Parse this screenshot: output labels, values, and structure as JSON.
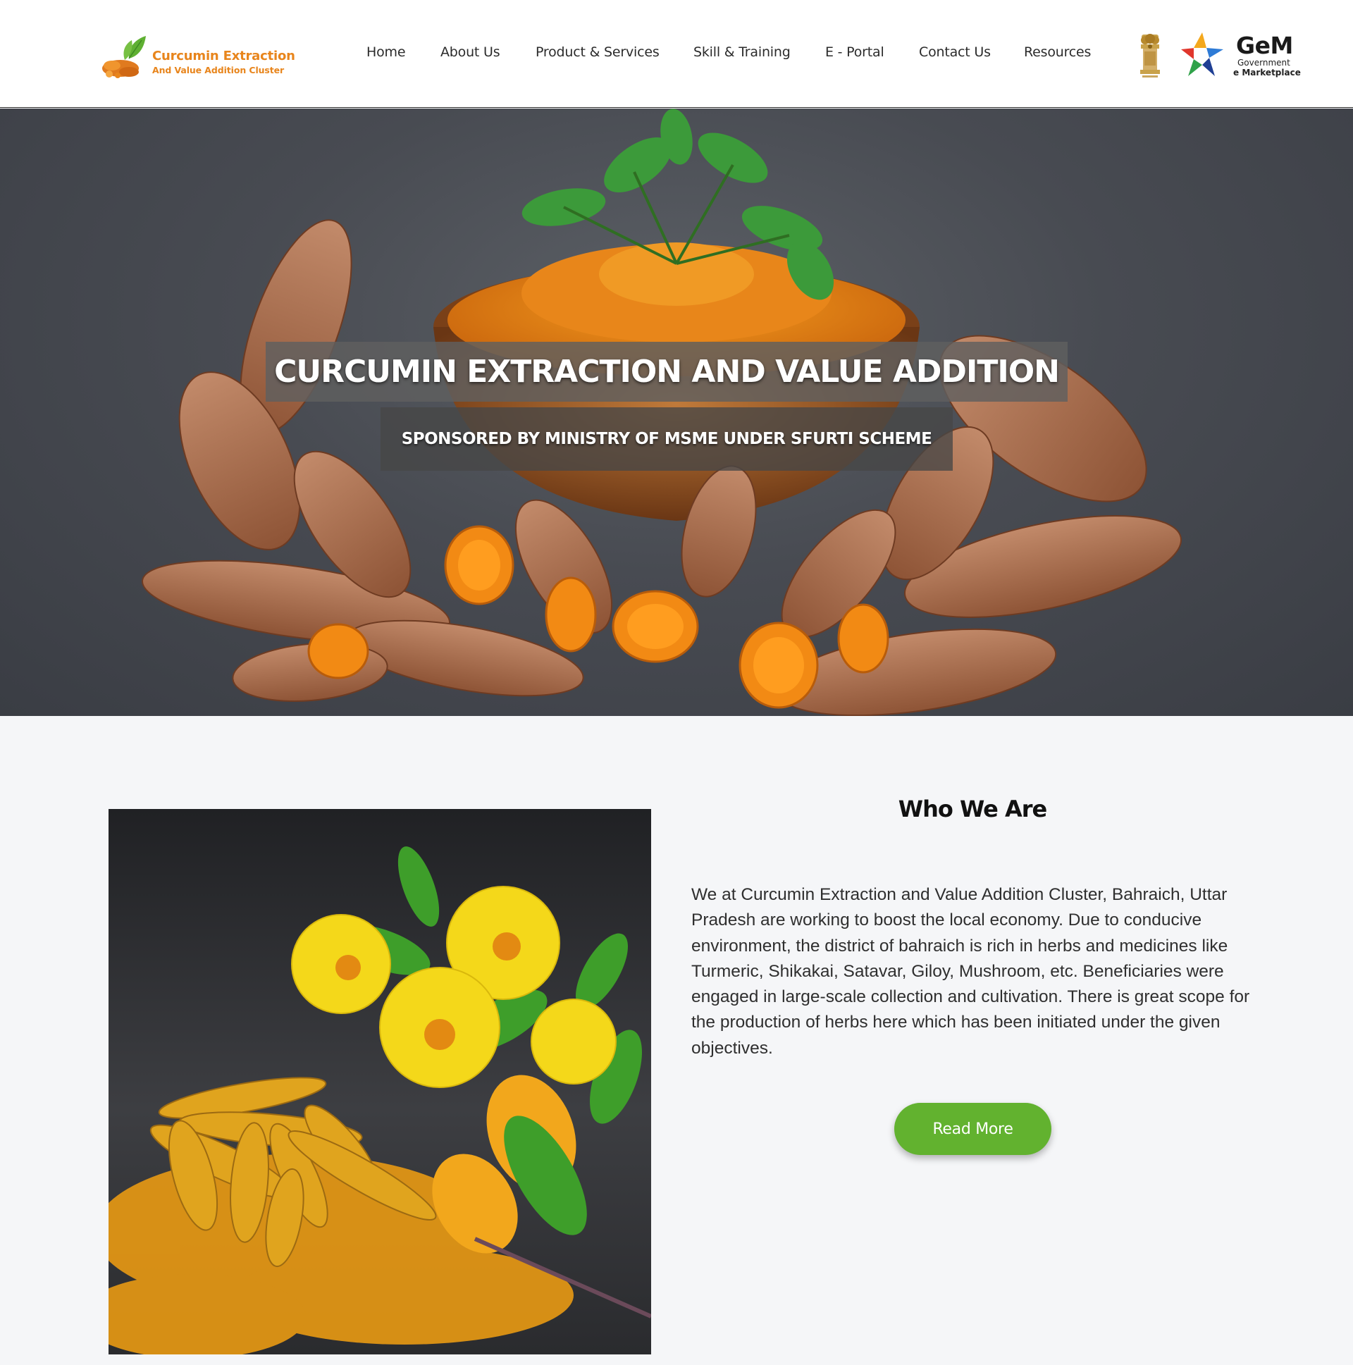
{
  "header": {
    "logo": {
      "title": "Curcumin Extraction",
      "subtitle": "And Value Addition Cluster"
    },
    "nav": [
      {
        "label": "Home"
      },
      {
        "label": "About Us"
      },
      {
        "label": "Product & Services"
      },
      {
        "label": "Skill & Training"
      },
      {
        "label": "E - Portal"
      },
      {
        "label": "Contact Us"
      },
      {
        "label": "Resources"
      }
    ],
    "emblem_icon": "national-emblem-icon",
    "gem": {
      "title": "GeM",
      "line1": "Government",
      "line2": "e Marketplace"
    }
  },
  "hero": {
    "title": "CURCUMIN EXTRACTION AND VALUE ADDITION",
    "subtitle": "SPONSORED BY MINISTRY OF MSME UNDER SFURTI SCHEME",
    "image": "turmeric-roots-and-powder-bowl-photo"
  },
  "about": {
    "heading": "Who We Are",
    "body": "We at Curcumin Extraction and Value Addition Cluster, Bahraich, Uttar Pradesh are working to boost the local economy. Due to conducive environment, the district of bahraich is rich in herbs and medicines like Turmeric, Shikakai, Satavar, Giloy, Mushroom, etc. Beneficiaries were engaged in large-scale collection and cultivation. There is great scope for the production of herbs here which has been initiated under the given objectives.",
    "button": "Read More",
    "image": "dried-turmeric-and-yellow-flowers-photo"
  },
  "colors": {
    "brand_orange": "#e8851c",
    "button_green": "#62b22f",
    "section_bg": "#f5f6f8"
  }
}
